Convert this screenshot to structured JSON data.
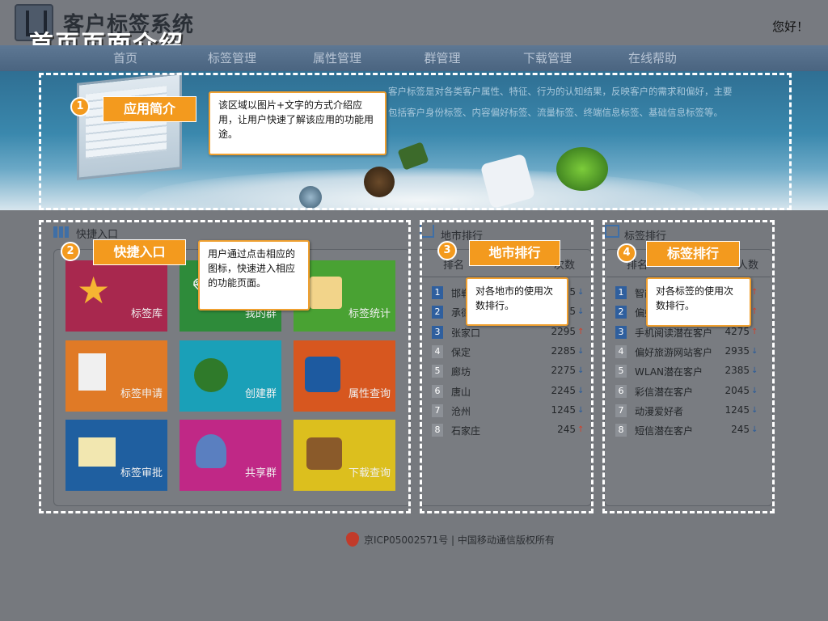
{
  "header": {
    "app_title": "客户标签系统",
    "page_caption": "首页页面介绍",
    "greeting": "您好！"
  },
  "nav": [
    {
      "label": "首页"
    },
    {
      "label": "标签管理"
    },
    {
      "label": "属性管理"
    },
    {
      "label": "群管理"
    },
    {
      "label": "下载管理"
    },
    {
      "label": "在线帮助"
    }
  ],
  "banner": {
    "desc_line1": "客户标签是对各类客户属性、特征、行为的认知结果，反映客户的需求和偏好，主要",
    "desc_line2": "包括客户身份标签、内容偏好标签、流量标签、终端信息标签、基础信息标签等。"
  },
  "callouts": [
    {
      "number": "1",
      "title": "应用简介",
      "note": "该区域以图片+文字的方式介绍应用，让用户快速了解该应用的功能用途。"
    },
    {
      "number": "2",
      "title": "快捷入口",
      "note": "用户通过点击相应的图标，快速进入相应的功能页面。"
    },
    {
      "number": "3",
      "title": "地市排行",
      "note": "对各地市的使用次数排行。"
    },
    {
      "number": "4",
      "title": "标签排行",
      "note": "对各标签的使用次数排行。"
    }
  ],
  "quick": {
    "title": "快捷入口",
    "tiles": [
      {
        "label": "标签库",
        "color": "#a8284e",
        "icon": "star-icon"
      },
      {
        "label": "我的群",
        "color": "#2e8b3a",
        "icon": "pen-icon"
      },
      {
        "label": "标签统计",
        "color": "#49a233",
        "icon": "note-icon"
      },
      {
        "label": "标签申请",
        "color": "#e07a26",
        "icon": "doc-add-icon"
      },
      {
        "label": "创建群",
        "color": "#1aa0b8",
        "icon": "group-icon"
      },
      {
        "label": "属性查询",
        "color": "#d7571f",
        "icon": "grid-icon"
      },
      {
        "label": "标签审批",
        "color": "#1f5fa0",
        "icon": "approve-icon"
      },
      {
        "label": "共享群",
        "color": "#c02886",
        "icon": "share-user-icon"
      },
      {
        "label": "下载查询",
        "color": "#dcbf1e",
        "icon": "download-icon"
      }
    ]
  },
  "city_rank": {
    "title": "地市排行",
    "col_rank": "排名",
    "col_count": "次数",
    "rows": [
      {
        "rank": "1",
        "name": "邯郸",
        "value": "5",
        "trend": "down"
      },
      {
        "rank": "2",
        "name": "承德",
        "value": "5",
        "trend": "down"
      },
      {
        "rank": "3",
        "name": "张家口",
        "value": "2295",
        "trend": "up"
      },
      {
        "rank": "4",
        "name": "保定",
        "value": "2285",
        "trend": "down"
      },
      {
        "rank": "5",
        "name": "廊坊",
        "value": "2275",
        "trend": "down"
      },
      {
        "rank": "6",
        "name": "唐山",
        "value": "2245",
        "trend": "down"
      },
      {
        "rank": "7",
        "name": "沧州",
        "value": "1245",
        "trend": "down"
      },
      {
        "rank": "8",
        "name": "石家庄",
        "value": "245",
        "trend": "up"
      }
    ]
  },
  "tag_rank": {
    "title": "标签排行",
    "col_rank": "排名",
    "col_count": "人数",
    "rows": [
      {
        "rank": "1",
        "name": "智能",
        "value": "",
        "trend": "up"
      },
      {
        "rank": "2",
        "name": "偏好",
        "value": "",
        "trend": "up"
      },
      {
        "rank": "3",
        "name": "手机阅读潜在客户",
        "value": "4275",
        "trend": "up"
      },
      {
        "rank": "4",
        "name": "偏好旅游网站客户",
        "value": "2935",
        "trend": "down"
      },
      {
        "rank": "5",
        "name": "WLAN潜在客户",
        "value": "2385",
        "trend": "down"
      },
      {
        "rank": "6",
        "name": "彩信潜在客户",
        "value": "2045",
        "trend": "down"
      },
      {
        "rank": "7",
        "name": "动漫爱好者",
        "value": "1245",
        "trend": "down"
      },
      {
        "rank": "8",
        "name": "短信潜在客户",
        "value": "245",
        "trend": "down"
      }
    ]
  },
  "footer": {
    "text": "京ICP05002571号 | 中国移动通信版权所有"
  }
}
